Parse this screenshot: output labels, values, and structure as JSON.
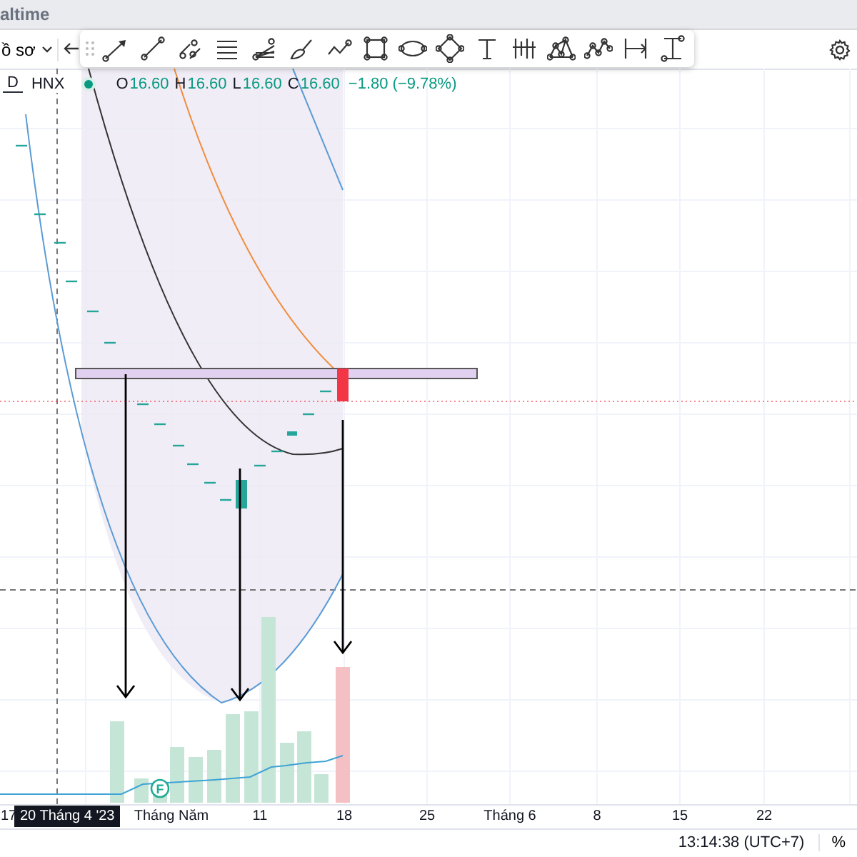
{
  "title_bar": {
    "title": "altime"
  },
  "toolbar": {
    "profile_dropdown": "ồ sơ"
  },
  "legend": {
    "interval": "D",
    "exchange": "HNX",
    "ohlc": [
      {
        "label": "O",
        "value": "16.60"
      },
      {
        "label": "H",
        "value": "16.60"
      },
      {
        "label": "L",
        "value": "16.60"
      },
      {
        "label": "C",
        "value": "16.60"
      }
    ],
    "change": "−1.80 (−9.78%)"
  },
  "volume_marker": "F",
  "time_axis": [
    {
      "kind": "tick",
      "label": "17"
    },
    {
      "kind": "crosshair",
      "label": "20 Tháng 4 '23"
    },
    {
      "kind": "tick",
      "label": "Tháng Năm"
    },
    {
      "kind": "tick",
      "label": "11"
    },
    {
      "kind": "tick",
      "label": "18"
    },
    {
      "kind": "tick",
      "label": "25"
    },
    {
      "kind": "tick",
      "label": "Tháng 6"
    },
    {
      "kind": "tick",
      "label": "8"
    },
    {
      "kind": "tick",
      "label": "15"
    },
    {
      "kind": "tick",
      "label": "22"
    }
  ],
  "status_bar": {
    "time": "13:14:38 (UTC+7)",
    "scale": "%"
  }
}
